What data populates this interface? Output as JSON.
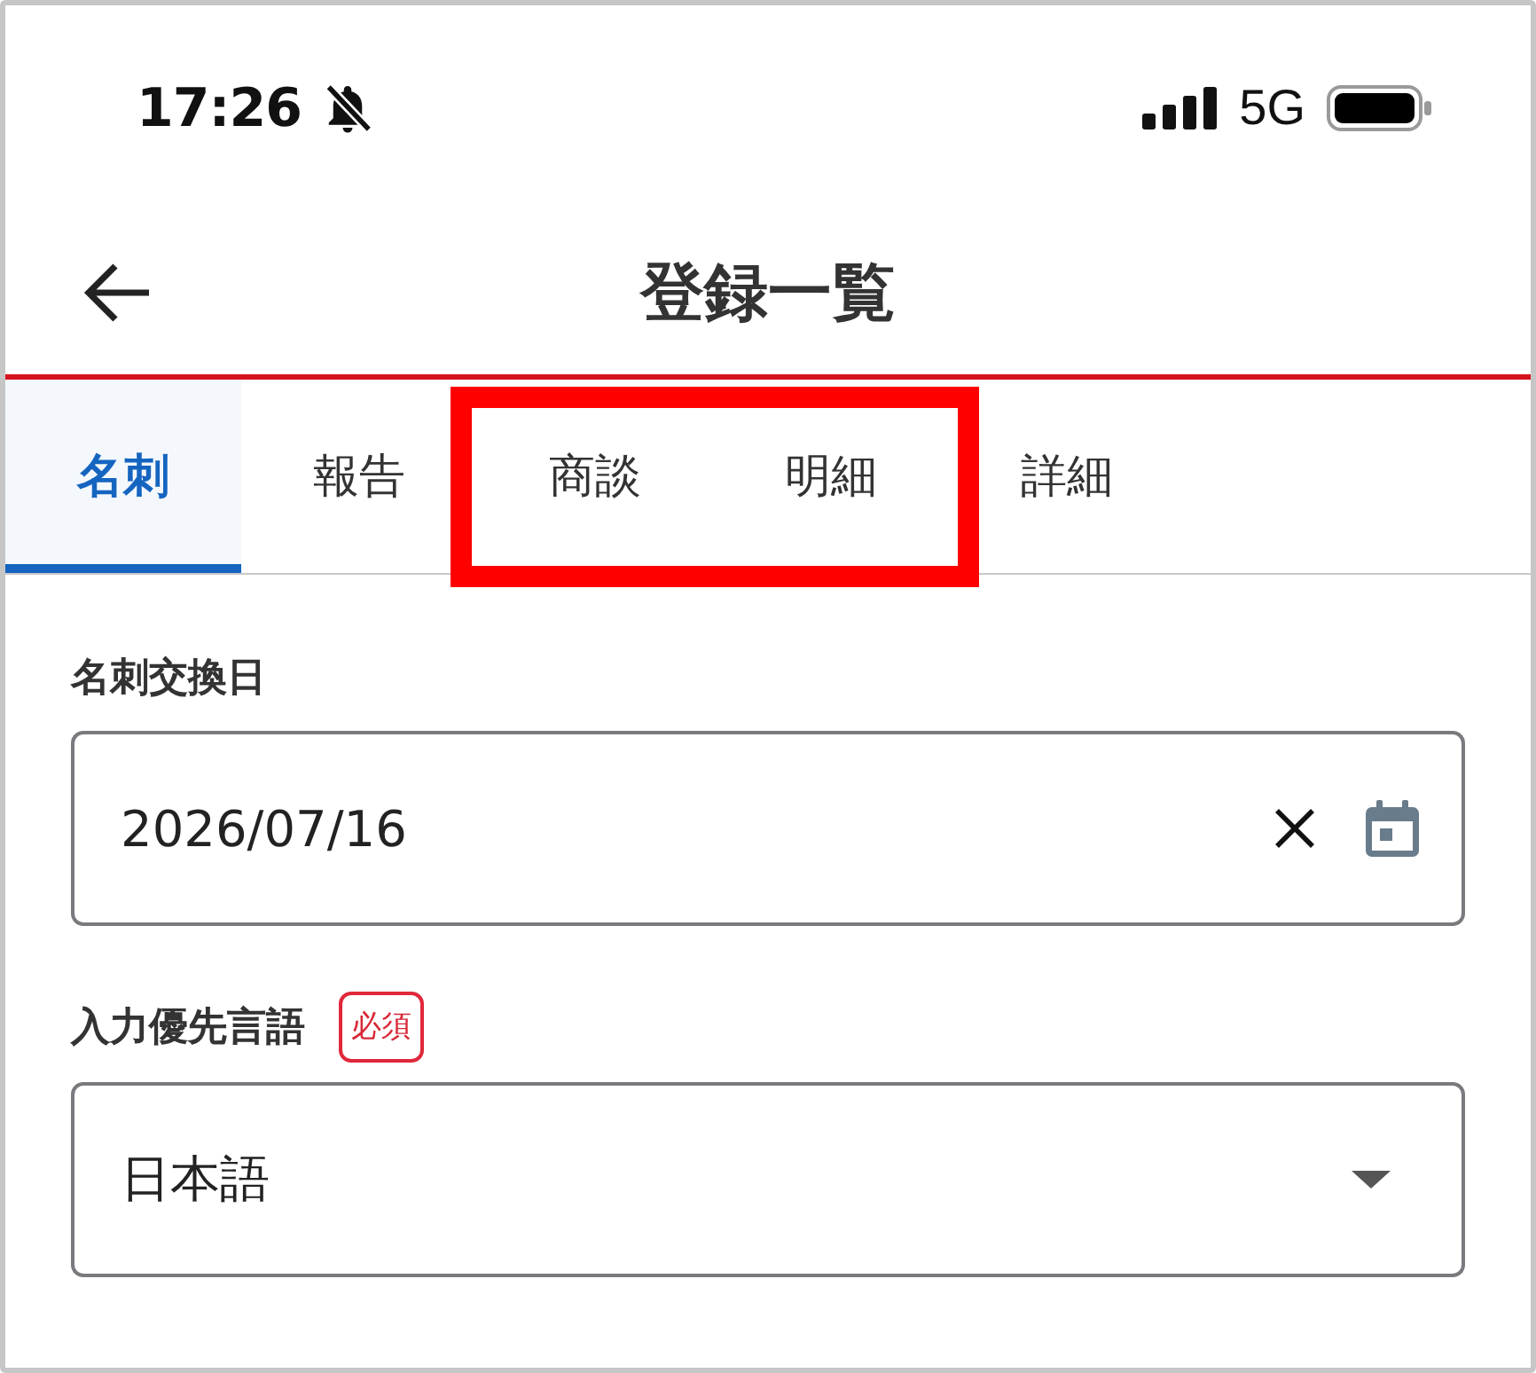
{
  "status_bar": {
    "time": "17:26",
    "network": "5G"
  },
  "header": {
    "title": "登録一覧"
  },
  "tabs": [
    {
      "label": "名刺",
      "selected": true,
      "highlighted": false
    },
    {
      "label": "報告",
      "selected": false,
      "highlighted": false
    },
    {
      "label": "商談",
      "selected": false,
      "highlighted": true
    },
    {
      "label": "明細",
      "selected": false,
      "highlighted": true
    },
    {
      "label": "詳細",
      "selected": false,
      "highlighted": false
    }
  ],
  "form": {
    "fields": [
      {
        "kind": "date",
        "label": "名刺交換日",
        "value": "2026/07/16"
      },
      {
        "kind": "select",
        "label": "入力優先言語",
        "badge": "必須",
        "value": "日本語"
      }
    ]
  }
}
